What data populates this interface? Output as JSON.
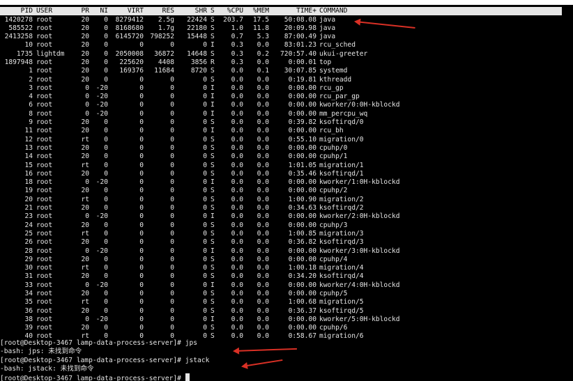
{
  "colors": {
    "terminal_bg": "#000000",
    "text": "#e6e6e6",
    "header_bg": "#e6e6e6",
    "annotation_arrow": "#d93025"
  },
  "header": {
    "pid": "PID",
    "user": "USER",
    "pr": "PR",
    "ni": "NI",
    "virt": "VIRT",
    "res": "RES",
    "shr": "SHR",
    "s": "S",
    "cpu": "%CPU",
    "mem": "%MEM",
    "time": "TIME+",
    "command": "COMMAND"
  },
  "processes": [
    {
      "pid": "1420278",
      "user": "root",
      "pr": "20",
      "ni": "0",
      "virt": "8279412",
      "res": "2.5g",
      "shr": "22424",
      "s": "S",
      "cpu": "203.7",
      "mem": "17.5",
      "time": "50:08.08",
      "cmd": "java"
    },
    {
      "pid": "585522",
      "user": "root",
      "pr": "20",
      "ni": "0",
      "virt": "8168680",
      "res": "1.7g",
      "shr": "22180",
      "s": "S",
      "cpu": "1.0",
      "mem": "11.8",
      "time": "20:09.98",
      "cmd": "java"
    },
    {
      "pid": "2413258",
      "user": "root",
      "pr": "20",
      "ni": "0",
      "virt": "6145720",
      "res": "798252",
      "shr": "15448",
      "s": "S",
      "cpu": "0.7",
      "mem": "5.3",
      "time": "87:00.49",
      "cmd": "java"
    },
    {
      "pid": "10",
      "user": "root",
      "pr": "20",
      "ni": "0",
      "virt": "0",
      "res": "0",
      "shr": "0",
      "s": "I",
      "cpu": "0.3",
      "mem": "0.0",
      "time": "83:01.23",
      "cmd": "rcu_sched"
    },
    {
      "pid": "1735",
      "user": "lightdm",
      "pr": "20",
      "ni": "0",
      "virt": "2050008",
      "res": "36872",
      "shr": "14648",
      "s": "S",
      "cpu": "0.3",
      "mem": "0.2",
      "time": "720:57.40",
      "cmd": "ukui-greeter"
    },
    {
      "pid": "1897948",
      "user": "root",
      "pr": "20",
      "ni": "0",
      "virt": "225620",
      "res": "4408",
      "shr": "3856",
      "s": "R",
      "cpu": "0.3",
      "mem": "0.0",
      "time": "0:00.01",
      "cmd": "top"
    },
    {
      "pid": "1",
      "user": "root",
      "pr": "20",
      "ni": "0",
      "virt": "169376",
      "res": "11684",
      "shr": "8720",
      "s": "S",
      "cpu": "0.0",
      "mem": "0.1",
      "time": "30:07.85",
      "cmd": "systemd"
    },
    {
      "pid": "2",
      "user": "root",
      "pr": "20",
      "ni": "0",
      "virt": "0",
      "res": "0",
      "shr": "0",
      "s": "S",
      "cpu": "0.0",
      "mem": "0.0",
      "time": "0:19.81",
      "cmd": "kthreadd"
    },
    {
      "pid": "3",
      "user": "root",
      "pr": "0",
      "ni": "-20",
      "virt": "0",
      "res": "0",
      "shr": "0",
      "s": "I",
      "cpu": "0.0",
      "mem": "0.0",
      "time": "0:00.00",
      "cmd": "rcu_gp"
    },
    {
      "pid": "4",
      "user": "root",
      "pr": "0",
      "ni": "-20",
      "virt": "0",
      "res": "0",
      "shr": "0",
      "s": "I",
      "cpu": "0.0",
      "mem": "0.0",
      "time": "0:00.00",
      "cmd": "rcu_par_gp"
    },
    {
      "pid": "6",
      "user": "root",
      "pr": "0",
      "ni": "-20",
      "virt": "0",
      "res": "0",
      "shr": "0",
      "s": "I",
      "cpu": "0.0",
      "mem": "0.0",
      "time": "0:00.00",
      "cmd": "kworker/0:0H-kblockd"
    },
    {
      "pid": "8",
      "user": "root",
      "pr": "0",
      "ni": "-20",
      "virt": "0",
      "res": "0",
      "shr": "0",
      "s": "I",
      "cpu": "0.0",
      "mem": "0.0",
      "time": "0:00.00",
      "cmd": "mm_percpu_wq"
    },
    {
      "pid": "9",
      "user": "root",
      "pr": "20",
      "ni": "0",
      "virt": "0",
      "res": "0",
      "shr": "0",
      "s": "S",
      "cpu": "0.0",
      "mem": "0.0",
      "time": "0:39.82",
      "cmd": "ksoftirqd/0"
    },
    {
      "pid": "11",
      "user": "root",
      "pr": "20",
      "ni": "0",
      "virt": "0",
      "res": "0",
      "shr": "0",
      "s": "I",
      "cpu": "0.0",
      "mem": "0.0",
      "time": "0:00.00",
      "cmd": "rcu_bh"
    },
    {
      "pid": "12",
      "user": "root",
      "pr": "rt",
      "ni": "0",
      "virt": "0",
      "res": "0",
      "shr": "0",
      "s": "S",
      "cpu": "0.0",
      "mem": "0.0",
      "time": "0:55.10",
      "cmd": "migration/0"
    },
    {
      "pid": "13",
      "user": "root",
      "pr": "20",
      "ni": "0",
      "virt": "0",
      "res": "0",
      "shr": "0",
      "s": "S",
      "cpu": "0.0",
      "mem": "0.0",
      "time": "0:00.00",
      "cmd": "cpuhp/0"
    },
    {
      "pid": "14",
      "user": "root",
      "pr": "20",
      "ni": "0",
      "virt": "0",
      "res": "0",
      "shr": "0",
      "s": "S",
      "cpu": "0.0",
      "mem": "0.0",
      "time": "0:00.00",
      "cmd": "cpuhp/1"
    },
    {
      "pid": "15",
      "user": "root",
      "pr": "rt",
      "ni": "0",
      "virt": "0",
      "res": "0",
      "shr": "0",
      "s": "S",
      "cpu": "0.0",
      "mem": "0.0",
      "time": "1:01.05",
      "cmd": "migration/1"
    },
    {
      "pid": "16",
      "user": "root",
      "pr": "20",
      "ni": "0",
      "virt": "0",
      "res": "0",
      "shr": "0",
      "s": "S",
      "cpu": "0.0",
      "mem": "0.0",
      "time": "0:35.46",
      "cmd": "ksoftirqd/1"
    },
    {
      "pid": "18",
      "user": "root",
      "pr": "0",
      "ni": "-20",
      "virt": "0",
      "res": "0",
      "shr": "0",
      "s": "I",
      "cpu": "0.0",
      "mem": "0.0",
      "time": "0:00.00",
      "cmd": "kworker/1:0H-kblockd"
    },
    {
      "pid": "19",
      "user": "root",
      "pr": "20",
      "ni": "0",
      "virt": "0",
      "res": "0",
      "shr": "0",
      "s": "S",
      "cpu": "0.0",
      "mem": "0.0",
      "time": "0:00.00",
      "cmd": "cpuhp/2"
    },
    {
      "pid": "20",
      "user": "root",
      "pr": "rt",
      "ni": "0",
      "virt": "0",
      "res": "0",
      "shr": "0",
      "s": "S",
      "cpu": "0.0",
      "mem": "0.0",
      "time": "1:00.90",
      "cmd": "migration/2"
    },
    {
      "pid": "21",
      "user": "root",
      "pr": "20",
      "ni": "0",
      "virt": "0",
      "res": "0",
      "shr": "0",
      "s": "S",
      "cpu": "0.0",
      "mem": "0.0",
      "time": "0:34.63",
      "cmd": "ksoftirqd/2"
    },
    {
      "pid": "23",
      "user": "root",
      "pr": "0",
      "ni": "-20",
      "virt": "0",
      "res": "0",
      "shr": "0",
      "s": "I",
      "cpu": "0.0",
      "mem": "0.0",
      "time": "0:00.00",
      "cmd": "kworker/2:0H-kblockd"
    },
    {
      "pid": "24",
      "user": "root",
      "pr": "20",
      "ni": "0",
      "virt": "0",
      "res": "0",
      "shr": "0",
      "s": "S",
      "cpu": "0.0",
      "mem": "0.0",
      "time": "0:00.00",
      "cmd": "cpuhp/3"
    },
    {
      "pid": "25",
      "user": "root",
      "pr": "rt",
      "ni": "0",
      "virt": "0",
      "res": "0",
      "shr": "0",
      "s": "S",
      "cpu": "0.0",
      "mem": "0.0",
      "time": "1:00.85",
      "cmd": "migration/3"
    },
    {
      "pid": "26",
      "user": "root",
      "pr": "20",
      "ni": "0",
      "virt": "0",
      "res": "0",
      "shr": "0",
      "s": "S",
      "cpu": "0.0",
      "mem": "0.0",
      "time": "0:36.82",
      "cmd": "ksoftirqd/3"
    },
    {
      "pid": "28",
      "user": "root",
      "pr": "0",
      "ni": "-20",
      "virt": "0",
      "res": "0",
      "shr": "0",
      "s": "I",
      "cpu": "0.0",
      "mem": "0.0",
      "time": "0:00.00",
      "cmd": "kworker/3:0H-kblockd"
    },
    {
      "pid": "29",
      "user": "root",
      "pr": "20",
      "ni": "0",
      "virt": "0",
      "res": "0",
      "shr": "0",
      "s": "S",
      "cpu": "0.0",
      "mem": "0.0",
      "time": "0:00.00",
      "cmd": "cpuhp/4"
    },
    {
      "pid": "30",
      "user": "root",
      "pr": "rt",
      "ni": "0",
      "virt": "0",
      "res": "0",
      "shr": "0",
      "s": "S",
      "cpu": "0.0",
      "mem": "0.0",
      "time": "1:00.18",
      "cmd": "migration/4"
    },
    {
      "pid": "31",
      "user": "root",
      "pr": "20",
      "ni": "0",
      "virt": "0",
      "res": "0",
      "shr": "0",
      "s": "S",
      "cpu": "0.0",
      "mem": "0.0",
      "time": "0:34.20",
      "cmd": "ksoftirqd/4"
    },
    {
      "pid": "33",
      "user": "root",
      "pr": "0",
      "ni": "-20",
      "virt": "0",
      "res": "0",
      "shr": "0",
      "s": "I",
      "cpu": "0.0",
      "mem": "0.0",
      "time": "0:00.00",
      "cmd": "kworker/4:0H-kblockd"
    },
    {
      "pid": "34",
      "user": "root",
      "pr": "20",
      "ni": "0",
      "virt": "0",
      "res": "0",
      "shr": "0",
      "s": "S",
      "cpu": "0.0",
      "mem": "0.0",
      "time": "0:00.00",
      "cmd": "cpuhp/5"
    },
    {
      "pid": "35",
      "user": "root",
      "pr": "rt",
      "ni": "0",
      "virt": "0",
      "res": "0",
      "shr": "0",
      "s": "S",
      "cpu": "0.0",
      "mem": "0.0",
      "time": "1:00.68",
      "cmd": "migration/5"
    },
    {
      "pid": "36",
      "user": "root",
      "pr": "20",
      "ni": "0",
      "virt": "0",
      "res": "0",
      "shr": "0",
      "s": "S",
      "cpu": "0.0",
      "mem": "0.0",
      "time": "0:36.37",
      "cmd": "ksoftirqd/5"
    },
    {
      "pid": "38",
      "user": "root",
      "pr": "0",
      "ni": "-20",
      "virt": "0",
      "res": "0",
      "shr": "0",
      "s": "I",
      "cpu": "0.0",
      "mem": "0.0",
      "time": "0:00.00",
      "cmd": "kworker/5:0H-kblockd"
    },
    {
      "pid": "39",
      "user": "root",
      "pr": "20",
      "ni": "0",
      "virt": "0",
      "res": "0",
      "shr": "0",
      "s": "S",
      "cpu": "0.0",
      "mem": "0.0",
      "time": "0:00.00",
      "cmd": "cpuhp/6"
    },
    {
      "pid": "40",
      "user": "root",
      "pr": "rt",
      "ni": "0",
      "virt": "0",
      "res": "0",
      "shr": "0",
      "s": "S",
      "cpu": "0.0",
      "mem": "0.0",
      "time": "0:58.67",
      "cmd": "migration/6"
    }
  ],
  "shell": {
    "prompt": "[root@Desktop-3467 lamp-data-process-server]# ",
    "cmd1": "jps",
    "err1": "-bash: jps: 未找到命令",
    "cmd2": "jstack",
    "err2": "-bash: jstack: 未找到命令",
    "cursor": "cursor-block"
  }
}
